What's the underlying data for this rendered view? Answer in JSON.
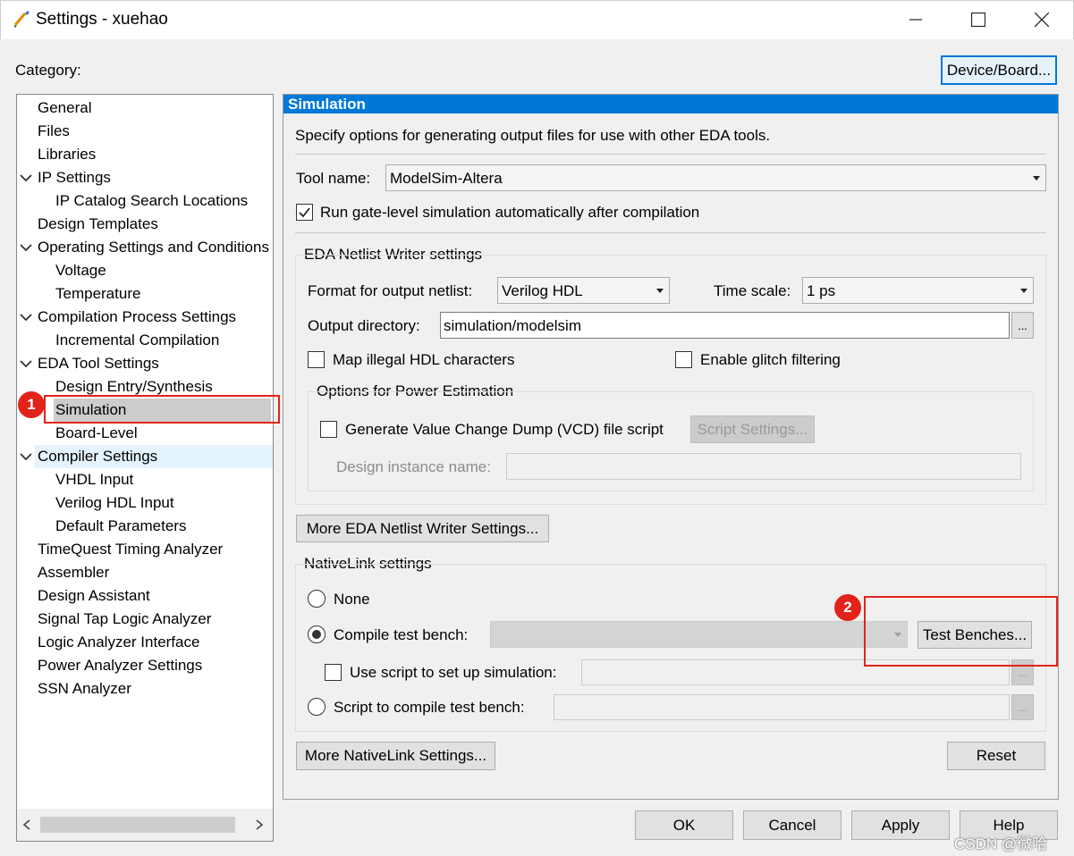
{
  "window": {
    "title": "Settings - xuehao"
  },
  "category_label": "Category:",
  "device_board_button": "Device/Board...",
  "tree": [
    {
      "label": "General",
      "level": 0
    },
    {
      "label": "Files",
      "level": 0
    },
    {
      "label": "Libraries",
      "level": 0
    },
    {
      "label": "IP Settings",
      "level": 0,
      "expanded": true
    },
    {
      "label": "IP Catalog Search Locations",
      "level": 1
    },
    {
      "label": "Design Templates",
      "level": 0
    },
    {
      "label": "Operating Settings and Conditions",
      "level": 0,
      "expanded": true
    },
    {
      "label": "Voltage",
      "level": 1
    },
    {
      "label": "Temperature",
      "level": 1
    },
    {
      "label": "Compilation Process Settings",
      "level": 0,
      "expanded": true
    },
    {
      "label": "Incremental Compilation",
      "level": 1
    },
    {
      "label": "EDA Tool Settings",
      "level": 0,
      "expanded": true
    },
    {
      "label": "Design Entry/Synthesis",
      "level": 1
    },
    {
      "label": "Simulation",
      "level": 1,
      "selected": true
    },
    {
      "label": "Board-Level",
      "level": 1
    },
    {
      "label": "Compiler Settings",
      "level": 0,
      "expanded": true,
      "hover": true
    },
    {
      "label": "VHDL Input",
      "level": 1
    },
    {
      "label": "Verilog HDL Input",
      "level": 1
    },
    {
      "label": "Default Parameters",
      "level": 1
    },
    {
      "label": "TimeQuest Timing Analyzer",
      "level": 0
    },
    {
      "label": "Assembler",
      "level": 0
    },
    {
      "label": "Design Assistant",
      "level": 0
    },
    {
      "label": "Signal Tap Logic Analyzer",
      "level": 0
    },
    {
      "label": "Logic Analyzer Interface",
      "level": 0
    },
    {
      "label": "Power Analyzer Settings",
      "level": 0
    },
    {
      "label": "SSN Analyzer",
      "level": 0
    }
  ],
  "panel": {
    "header": "Simulation",
    "description": "Specify options for generating output files for use with other EDA tools.",
    "tool_name_label": "Tool name:",
    "tool_name_value": "ModelSim-Altera",
    "run_gate_level_label": "Run gate-level simulation automatically after compilation",
    "run_gate_level_checked": true,
    "eda_group_title": "EDA Netlist Writer settings",
    "format_label": "Format for output netlist:",
    "format_value": "Verilog HDL",
    "timescale_label": "Time scale:",
    "timescale_value": "1 ps",
    "output_dir_label": "Output directory:",
    "output_dir_value": "simulation/modelsim",
    "browse_label": "...",
    "map_illegal_label": "Map illegal HDL characters",
    "map_illegal_checked": false,
    "glitch_label": "Enable glitch filtering",
    "glitch_checked": false,
    "power_group_title": "Options for Power Estimation",
    "vcd_label": "Generate Value Change Dump (VCD) file script",
    "vcd_checked": false,
    "script_settings_button": "Script Settings...",
    "design_instance_label": "Design instance name:",
    "design_instance_value": "",
    "more_eda_button": "More EDA Netlist Writer Settings...",
    "nativelink_group_title": "NativeLink settings",
    "radio_none_label": "None",
    "radio_compile_label": "Compile test bench:",
    "compile_tb_value": "",
    "test_benches_button": "Test Benches...",
    "use_script_label": "Use script to set up simulation:",
    "use_script_value": "",
    "radio_script_label": "Script to compile test bench:",
    "script_compile_value": "",
    "selected_radio": "compile",
    "more_nativelink_button": "More NativeLink Settings...",
    "reset_button": "Reset"
  },
  "footer": {
    "ok": "OK",
    "cancel": "Cancel",
    "apply": "Apply",
    "help": "Help"
  },
  "annotations": {
    "marker1": "1",
    "marker2": "2"
  },
  "watermark": "CSDN @微哈",
  "colors": {
    "accent": "#0078d7",
    "selection": "#cccccc",
    "hover": "#e5f3ff",
    "annotation": "#e2231a"
  }
}
